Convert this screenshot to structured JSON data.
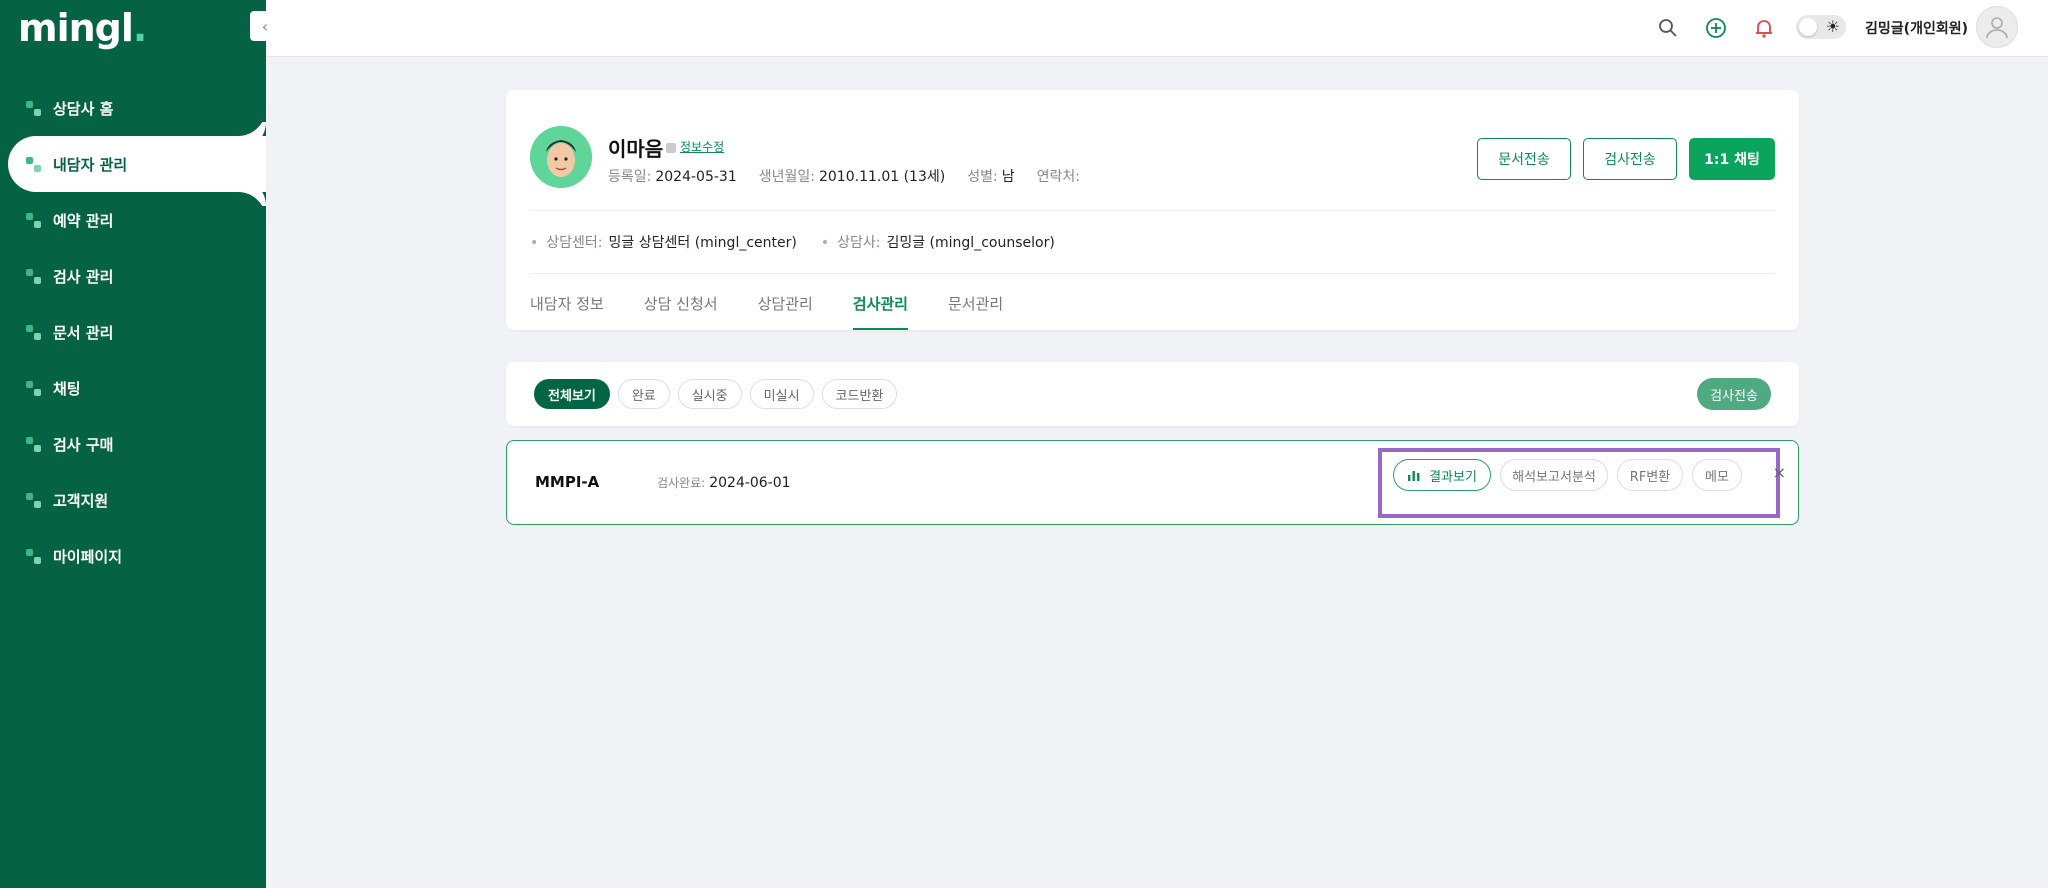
{
  "brand": {
    "logo": "mingl",
    "logo_dot": "."
  },
  "sidebar": {
    "items": [
      {
        "label": "상담사 홈",
        "icon": "home-icon"
      },
      {
        "label": "내담자 관리",
        "icon": "client-icon",
        "active": true
      },
      {
        "label": "예약 관리",
        "icon": "calendar-icon"
      },
      {
        "label": "검사 관리",
        "icon": "test-icon"
      },
      {
        "label": "문서 관리",
        "icon": "document-icon"
      },
      {
        "label": "채팅",
        "icon": "chat-icon"
      },
      {
        "label": "검사 구매",
        "icon": "purchase-icon"
      },
      {
        "label": "고객지원",
        "icon": "support-icon"
      },
      {
        "label": "마이페이지",
        "icon": "user-icon"
      }
    ],
    "collapse_glyph": "‹"
  },
  "header": {
    "user_name": "김밍글(개인회원)",
    "icons": [
      "search-icon",
      "add-circle-icon",
      "bell-icon",
      "theme-toggle",
      "avatar-icon"
    ]
  },
  "profile": {
    "name": "이마음",
    "edit_label": "정보수정",
    "reg_label": "등록일:",
    "reg_value": "2024-05-31",
    "birth_label": "생년월일:",
    "birth_value": "2010.11.01 (13세)",
    "gender_label": "성별:",
    "gender_value": "남",
    "contact_label": "연락처:",
    "contact_value": "",
    "center_label": "상담센터:",
    "center_value": "밍글 상담센터 (mingl_center)",
    "counselor_label": "상담사:",
    "counselor_value": "김밍글 (mingl_counselor)",
    "btn_doc": "문서전송",
    "btn_test": "검사전송",
    "btn_chat": "1:1 채팅"
  },
  "tabs": [
    {
      "label": "내담자 정보"
    },
    {
      "label": "상담 신청서"
    },
    {
      "label": "상담관리"
    },
    {
      "label": "검사관리",
      "active": true
    },
    {
      "label": "문서관리"
    }
  ],
  "filters": {
    "chips": [
      "전체보기",
      "완료",
      "실시중",
      "미실시",
      "코드반환"
    ],
    "active": "전체보기",
    "send_label": "검사전송"
  },
  "result": {
    "test_name": "MMPI-A",
    "done_label": "검사완료:",
    "done_date": "2024-06-01",
    "actions": [
      "결과보기",
      "해석보고서분석",
      "RF변환",
      "메모"
    ],
    "close_glyph": "×"
  },
  "colors": {
    "sidebar": "#056344",
    "accent": "#0aa45d",
    "highlight_box": "#9a66c7"
  }
}
